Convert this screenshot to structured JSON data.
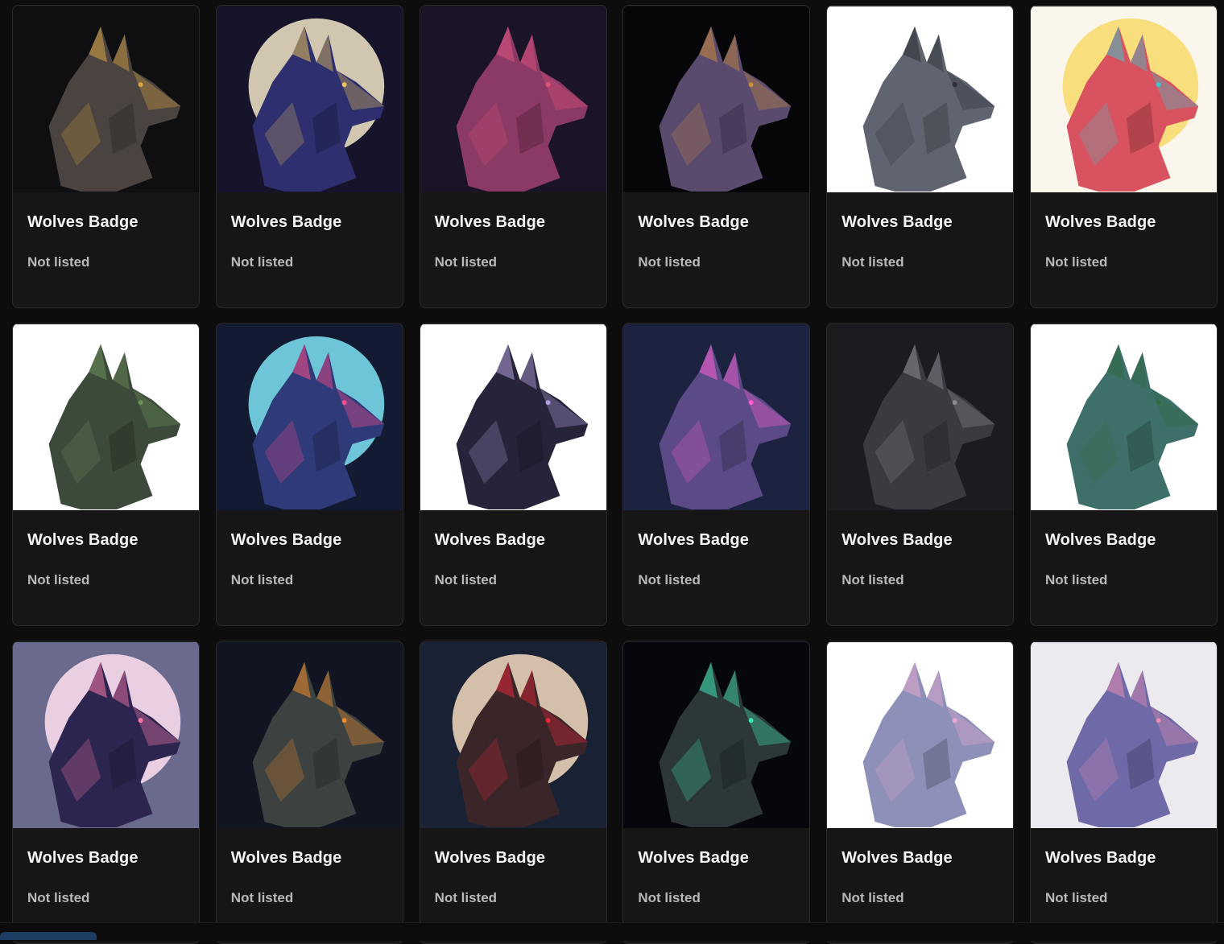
{
  "badges": [
    {
      "title": "Wolves Badge",
      "status": "Not listed",
      "image": "wolf-crown-dark-icon",
      "bg": "#0f0f12",
      "fur": "#4a4340",
      "accent": "#d9a441",
      "glow": ""
    },
    {
      "title": "Wolves Badge",
      "status": "Not listed",
      "image": "wolf-crown-moon-icon",
      "bg": "#15142a",
      "fur": "#2d2f6e",
      "accent": "#e8c05a",
      "glow": "#f2e6c8"
    },
    {
      "title": "Wolves Badge",
      "status": "Not listed",
      "image": "wolf-pink-cards-icon",
      "bg": "#1a1426",
      "fur": "#8a3a64",
      "accent": "#e0527f",
      "glow": ""
    },
    {
      "title": "Wolves Badge",
      "status": "Not listed",
      "image": "wolf-steampunk-icon",
      "bg": "#060608",
      "fur": "#5a4a6e",
      "accent": "#c98b3a",
      "glow": ""
    },
    {
      "title": "Wolves Badge",
      "status": "Not listed",
      "image": "wolf-gray-howling-icon",
      "bg": "#ffffff",
      "fur": "#5f6470",
      "accent": "#2c2e34",
      "glow": ""
    },
    {
      "title": "Wolves Badge",
      "status": "Not listed",
      "image": "wolf-rainbow-icon",
      "bg": "#fbf6ec",
      "fur": "#d9525f",
      "accent": "#3fc2c9",
      "glow": "#f7d96a"
    },
    {
      "title": "Wolves Badge",
      "status": "Not listed",
      "image": "wolf-forest-green-icon",
      "bg": "#ffffff",
      "fur": "#3c4a3a",
      "accent": "#6b8f5a",
      "glow": ""
    },
    {
      "title": "Wolves Badge",
      "status": "Not listed",
      "image": "wolf-cyan-moon-icon",
      "bg": "#131b33",
      "fur": "#2f3a78",
      "accent": "#ff4d8a",
      "glow": "#7fe3f5"
    },
    {
      "title": "Wolves Badge",
      "status": "Not listed",
      "image": "wolf-dark-geometric-icon",
      "bg": "#ffffff",
      "fur": "#26243a",
      "accent": "#b39ddb",
      "glow": ""
    },
    {
      "title": "Wolves Badge",
      "status": "Not listed",
      "image": "wolf-neon-glitch-icon",
      "bg": "#1c2340",
      "fur": "#5b4a86",
      "accent": "#ff5fd2",
      "glow": ""
    },
    {
      "title": "Wolves Badge",
      "status": "Not listed",
      "image": "wolf-dark-snarl-icon",
      "bg": "#1c1c20",
      "fur": "#3a3a40",
      "accent": "#8a8a92",
      "glow": ""
    },
    {
      "title": "Wolves Badge",
      "status": "Not listed",
      "image": "wolf-forest-teal-icon",
      "bg": "#ffffff",
      "fur": "#3f6f6a",
      "accent": "#2f6b3e",
      "glow": ""
    },
    {
      "title": "Wolves Badge",
      "status": "Not listed",
      "image": "wolf-cosmic-burst-icon",
      "bg": "#6a6a8e",
      "fur": "#2c2550",
      "accent": "#ff7aa8",
      "glow": "#ffe1f0"
    },
    {
      "title": "Wolves Badge",
      "status": "Not listed",
      "image": "wolf-orange-shards-icon",
      "bg": "#111521",
      "fur": "#3d4240",
      "accent": "#f08a2c",
      "glow": ""
    },
    {
      "title": "Wolves Badge",
      "status": "Not listed",
      "image": "wolf-red-moon-icon",
      "bg": "#182234",
      "fur": "#3a2628",
      "accent": "#e3263a",
      "glow": "#f6dcc0"
    },
    {
      "title": "Wolves Badge",
      "status": "Not listed",
      "image": "wolf-teal-mechanical-icon",
      "bg": "#06070c",
      "fur": "#2c3838",
      "accent": "#3fe3b6",
      "glow": ""
    },
    {
      "title": "Wolves Badge",
      "status": "Not listed",
      "image": "wolf-pastel-forest-icon",
      "bg": "#ffffff",
      "fur": "#8d90b8",
      "accent": "#e8a8d0",
      "glow": ""
    },
    {
      "title": "Wolves Badge",
      "status": "Not listed",
      "image": "wolf-lavender-geometric-icon",
      "bg": "#ece9ef",
      "fur": "#6e6aa8",
      "accent": "#e58bb0",
      "glow": ""
    }
  ]
}
